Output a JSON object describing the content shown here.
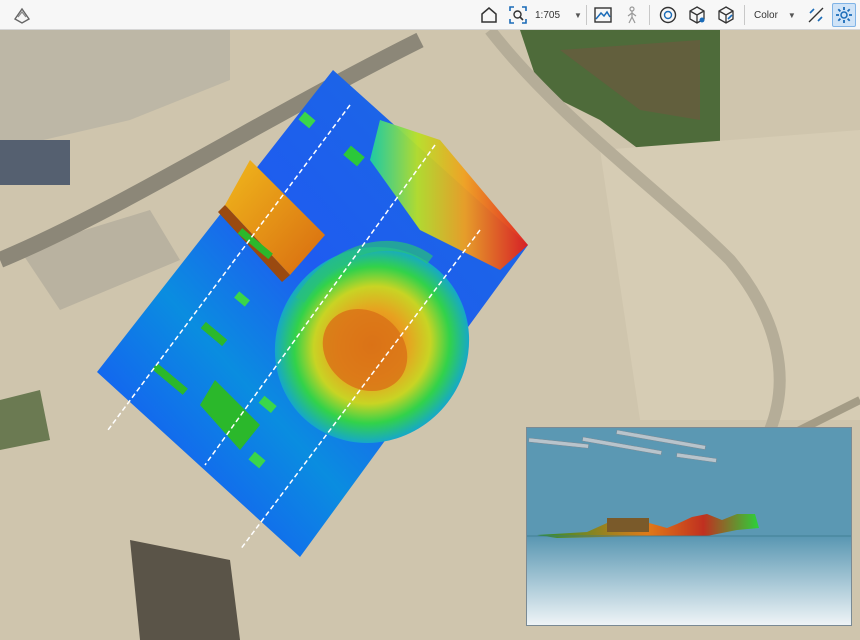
{
  "toolbar": {
    "app_icon": "app-logo-icon",
    "scale": {
      "label": "1:705"
    },
    "color_mode": {
      "label": "Color"
    },
    "icons": [
      "home-icon",
      "zoom-extent-icon",
      "terrain-icon",
      "person-walk-icon",
      "orbit-icon",
      "box-view-icon",
      "perspective-icon",
      "profile-tool-icon",
      "settings-gear-icon"
    ]
  },
  "colors": {
    "toolbar_bg": "#f7f7f7",
    "elevation_low": "#1e3cff",
    "elevation_mid": "#32d24a",
    "elevation_high": "#e01c1c",
    "active_button_bg": "#cfe3f7"
  },
  "viewer": {
    "name": "3d-preview-inset"
  }
}
